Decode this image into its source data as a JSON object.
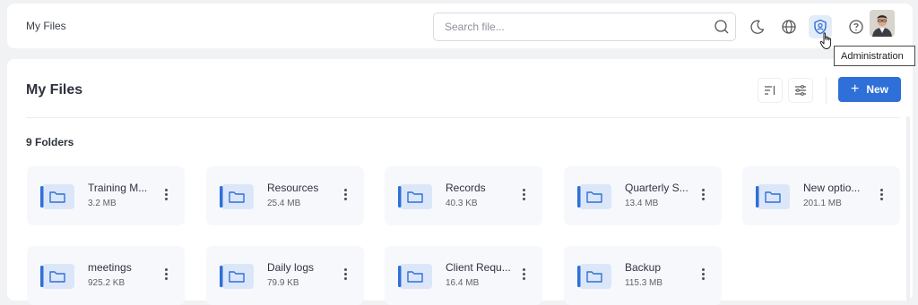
{
  "header": {
    "breadcrumb": "My Files",
    "search_placeholder": "Search file...",
    "icons": [
      "search-icon",
      "moon-icon",
      "globe-icon",
      "admin-shield-icon",
      "help-icon"
    ],
    "tooltip": "Administration"
  },
  "main": {
    "title": "My Files",
    "new_label": "New",
    "section_label": "9 Folders",
    "accent_color": "#2f6fd8",
    "folders": [
      {
        "name": "Training M...",
        "size": "3.2 MB"
      },
      {
        "name": "Resources",
        "size": "25.4 MB"
      },
      {
        "name": "Records",
        "size": "40.3 KB"
      },
      {
        "name": "Quarterly S...",
        "size": "13.4 MB"
      },
      {
        "name": "New optio...",
        "size": "201.1 MB"
      },
      {
        "name": "meetings",
        "size": "925.2 KB"
      },
      {
        "name": "Daily logs",
        "size": "79.9 KB"
      },
      {
        "name": "Client Requ...",
        "size": "16.4 MB"
      },
      {
        "name": "Backup",
        "size": "115.3 MB"
      }
    ]
  }
}
